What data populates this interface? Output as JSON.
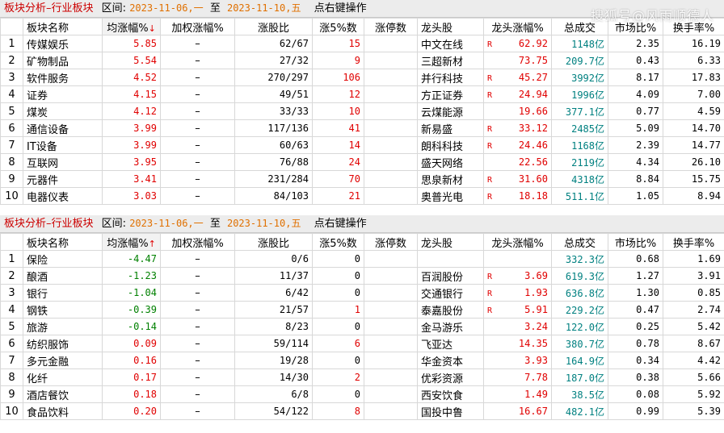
{
  "watermark": "搜狐号@风雨顺德人",
  "top": {
    "title": "板块分析–行业板块",
    "range_label": "区间:",
    "start_date": "2023-11-06,一",
    "sep": "至",
    "end_date": "2023-11-10,五",
    "action": "点右键操作",
    "headers": {
      "idx": "",
      "name": "板块名称",
      "avg": "均涨幅%",
      "sort_arrow": "↓",
      "wavg": "加权涨幅%",
      "ratio": "涨股比",
      "up5": "涨5%数",
      "limit": "涨停数",
      "leader": "龙头股",
      "lead_chg": "龙头涨幅%",
      "turnover": "总成交",
      "mkt": "市场比%",
      "hsl": "换手率%"
    },
    "rows": [
      {
        "idx": "1",
        "name": "传媒娱乐",
        "avg": "5.85",
        "wavg": "–",
        "ratio": "62/67",
        "up5": "15",
        "limit": "",
        "leader": "中文在线",
        "r": "R",
        "lead_chg": "62.92",
        "turnover": "1148亿",
        "mkt": "2.35",
        "hsl": "16.19"
      },
      {
        "idx": "2",
        "name": "矿物制品",
        "avg": "5.54",
        "wavg": "–",
        "ratio": "27/32",
        "up5": "9",
        "limit": "",
        "leader": "三超新材",
        "r": "",
        "lead_chg": "73.75",
        "turnover": "209.7亿",
        "mkt": "0.43",
        "hsl": "6.33"
      },
      {
        "idx": "3",
        "name": "软件服务",
        "avg": "4.52",
        "wavg": "–",
        "ratio": "270/297",
        "up5": "106",
        "limit": "",
        "leader": "并行科技",
        "r": "R",
        "lead_chg": "45.27",
        "turnover": "3992亿",
        "mkt": "8.17",
        "hsl": "17.83"
      },
      {
        "idx": "4",
        "name": "证券",
        "avg": "4.15",
        "wavg": "–",
        "ratio": "49/51",
        "up5": "12",
        "limit": "",
        "leader": "方正证券",
        "r": "R",
        "lead_chg": "24.94",
        "turnover": "1996亿",
        "mkt": "4.09",
        "hsl": "7.00"
      },
      {
        "idx": "5",
        "name": "煤炭",
        "avg": "4.12",
        "wavg": "–",
        "ratio": "33/33",
        "up5": "10",
        "limit": "",
        "leader": "云煤能源",
        "r": "",
        "lead_chg": "19.66",
        "turnover": "377.1亿",
        "mkt": "0.77",
        "hsl": "4.59"
      },
      {
        "idx": "6",
        "name": "通信设备",
        "avg": "3.99",
        "wavg": "–",
        "ratio": "117/136",
        "up5": "41",
        "limit": "",
        "leader": "新易盛",
        "r": "R",
        "lead_chg": "33.12",
        "turnover": "2485亿",
        "mkt": "5.09",
        "hsl": "14.70"
      },
      {
        "idx": "7",
        "name": "IT设备",
        "avg": "3.99",
        "wavg": "–",
        "ratio": "60/63",
        "up5": "14",
        "limit": "",
        "leader": "朗科科技",
        "r": "R",
        "lead_chg": "24.46",
        "turnover": "1168亿",
        "mkt": "2.39",
        "hsl": "14.77"
      },
      {
        "idx": "8",
        "name": "互联网",
        "avg": "3.95",
        "wavg": "–",
        "ratio": "76/88",
        "up5": "24",
        "limit": "",
        "leader": "盛天网络",
        "r": "",
        "lead_chg": "22.56",
        "turnover": "2119亿",
        "mkt": "4.34",
        "hsl": "26.10"
      },
      {
        "idx": "9",
        "name": "元器件",
        "avg": "3.41",
        "wavg": "–",
        "ratio": "231/284",
        "up5": "70",
        "limit": "",
        "leader": "思泉新材",
        "r": "R",
        "lead_chg": "31.60",
        "turnover": "4318亿",
        "mkt": "8.84",
        "hsl": "15.75"
      },
      {
        "idx": "10",
        "name": "电器仪表",
        "avg": "3.03",
        "wavg": "–",
        "ratio": "84/103",
        "up5": "21",
        "limit": "",
        "leader": "奥普光电",
        "r": "R",
        "lead_chg": "18.18",
        "turnover": "511.1亿",
        "mkt": "1.05",
        "hsl": "8.94"
      }
    ]
  },
  "bottom": {
    "title": "板块分析–行业板块",
    "range_label": "区间:",
    "start_date": "2023-11-06,一",
    "sep": "至",
    "end_date": "2023-11-10,五",
    "action": "点右键操作",
    "headers": {
      "idx": "",
      "name": "板块名称",
      "avg": "均涨幅%",
      "sort_arrow": "↑",
      "wavg": "加权涨幅%",
      "ratio": "涨股比",
      "up5": "涨5%数",
      "limit": "涨停数",
      "leader": "龙头股",
      "lead_chg": "龙头涨幅%",
      "turnover": "总成交",
      "mkt": "市场比%",
      "hsl": "换手率%"
    },
    "rows": [
      {
        "idx": "1",
        "name": "保险",
        "avg": "-4.47",
        "wavg": "–",
        "ratio": "0/6",
        "up5": "0",
        "limit": "",
        "leader": "",
        "r": "",
        "lead_chg": "",
        "turnover": "332.3亿",
        "mkt": "0.68",
        "hsl": "1.69"
      },
      {
        "idx": "2",
        "name": "酿酒",
        "avg": "-1.23",
        "wavg": "–",
        "ratio": "11/37",
        "up5": "0",
        "limit": "",
        "leader": "百润股份",
        "r": "R",
        "lead_chg": "3.69",
        "turnover": "619.3亿",
        "mkt": "1.27",
        "hsl": "3.91"
      },
      {
        "idx": "3",
        "name": "银行",
        "avg": "-1.04",
        "wavg": "–",
        "ratio": "6/42",
        "up5": "0",
        "limit": "",
        "leader": "交通银行",
        "r": "R",
        "lead_chg": "1.93",
        "turnover": "636.8亿",
        "mkt": "1.30",
        "hsl": "0.85"
      },
      {
        "idx": "4",
        "name": "钢铁",
        "avg": "-0.39",
        "wavg": "–",
        "ratio": "21/57",
        "up5": "1",
        "limit": "",
        "leader": "泰嘉股份",
        "r": "R",
        "lead_chg": "5.91",
        "turnover": "229.2亿",
        "mkt": "0.47",
        "hsl": "2.74"
      },
      {
        "idx": "5",
        "name": "旅游",
        "avg": "-0.14",
        "wavg": "–",
        "ratio": "8/23",
        "up5": "0",
        "limit": "",
        "leader": "金马游乐",
        "r": "",
        "lead_chg": "3.24",
        "turnover": "122.0亿",
        "mkt": "0.25",
        "hsl": "5.42"
      },
      {
        "idx": "6",
        "name": "纺织服饰",
        "avg": "0.09",
        "wavg": "–",
        "ratio": "59/114",
        "up5": "6",
        "limit": "",
        "leader": "飞亚达",
        "r": "",
        "lead_chg": "14.35",
        "turnover": "380.7亿",
        "mkt": "0.78",
        "hsl": "8.67"
      },
      {
        "idx": "7",
        "name": "多元金融",
        "avg": "0.16",
        "wavg": "–",
        "ratio": "19/28",
        "up5": "0",
        "limit": "",
        "leader": "华金资本",
        "r": "",
        "lead_chg": "3.93",
        "turnover": "164.9亿",
        "mkt": "0.34",
        "hsl": "4.42"
      },
      {
        "idx": "8",
        "name": "化纤",
        "avg": "0.17",
        "wavg": "–",
        "ratio": "14/30",
        "up5": "2",
        "limit": "",
        "leader": "优彩资源",
        "r": "",
        "lead_chg": "7.78",
        "turnover": "187.0亿",
        "mkt": "0.38",
        "hsl": "5.66"
      },
      {
        "idx": "9",
        "name": "酒店餐饮",
        "avg": "0.18",
        "wavg": "–",
        "ratio": "6/8",
        "up5": "0",
        "limit": "",
        "leader": "西安饮食",
        "r": "",
        "lead_chg": "1.49",
        "turnover": "38.5亿",
        "mkt": "0.08",
        "hsl": "5.92"
      },
      {
        "idx": "10",
        "name": "食品饮料",
        "avg": "0.20",
        "wavg": "–",
        "ratio": "54/122",
        "up5": "8",
        "limit": "",
        "leader": "国投中鲁",
        "r": "",
        "lead_chg": "16.67",
        "turnover": "482.1亿",
        "mkt": "0.99",
        "hsl": "5.39"
      }
    ]
  }
}
